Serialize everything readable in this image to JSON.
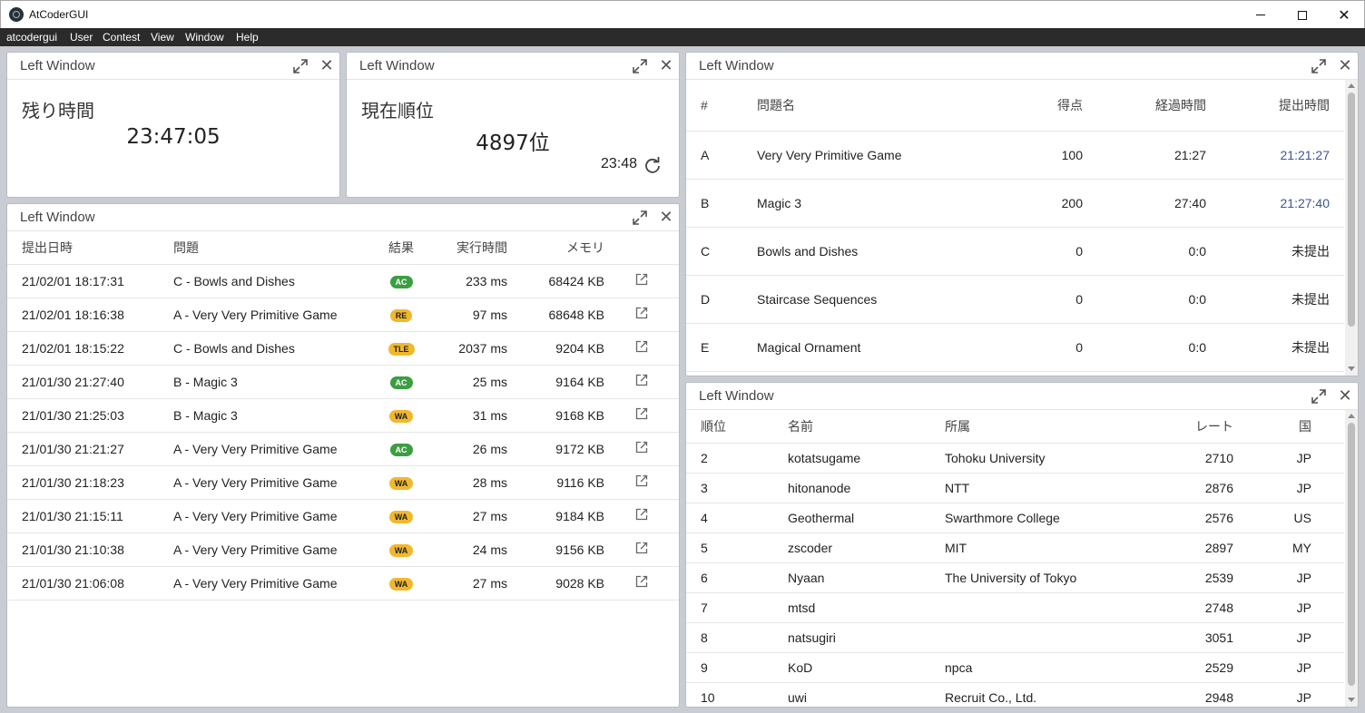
{
  "app": {
    "title": "AtCoderGUI"
  },
  "menu": [
    "atcodergui",
    "User",
    "Contest",
    "View",
    "Window",
    "Help"
  ],
  "panels": {
    "remaining": {
      "title": "Left Window",
      "label": "残り時間",
      "value": "23:47:05"
    },
    "rank": {
      "title": "Left Window",
      "label": "現在順位",
      "value": "4897位",
      "updated": "23:48"
    },
    "submissions": {
      "title": "Left Window",
      "headers": [
        "提出日時",
        "問題",
        "結果",
        "実行時間",
        "メモリ"
      ],
      "rows": [
        {
          "date": "21/02/01 18:17:31",
          "problem": "C - Bowls and Dishes",
          "result": "AC",
          "time": "233 ms",
          "memory": "68424 KB"
        },
        {
          "date": "21/02/01 18:16:38",
          "problem": "A - Very Very Primitive Game",
          "result": "RE",
          "time": "97 ms",
          "memory": "68648 KB"
        },
        {
          "date": "21/02/01 18:15:22",
          "problem": "C - Bowls and Dishes",
          "result": "TLE",
          "time": "2037 ms",
          "memory": "9204 KB"
        },
        {
          "date": "21/01/30 21:27:40",
          "problem": "B - Magic 3",
          "result": "AC",
          "time": "25 ms",
          "memory": "9164 KB"
        },
        {
          "date": "21/01/30 21:25:03",
          "problem": "B - Magic 3",
          "result": "WA",
          "time": "31 ms",
          "memory": "9168 KB"
        },
        {
          "date": "21/01/30 21:21:27",
          "problem": "A - Very Very Primitive Game",
          "result": "AC",
          "time": "26 ms",
          "memory": "9172 KB"
        },
        {
          "date": "21/01/30 21:18:23",
          "problem": "A - Very Very Primitive Game",
          "result": "WA",
          "time": "28 ms",
          "memory": "9116 KB"
        },
        {
          "date": "21/01/30 21:15:11",
          "problem": "A - Very Very Primitive Game",
          "result": "WA",
          "time": "27 ms",
          "memory": "9184 KB"
        },
        {
          "date": "21/01/30 21:10:38",
          "problem": "A - Very Very Primitive Game",
          "result": "WA",
          "time": "24 ms",
          "memory": "9156 KB"
        },
        {
          "date": "21/01/30 21:06:08",
          "problem": "A - Very Very Primitive Game",
          "result": "WA",
          "time": "27 ms",
          "memory": "9028 KB"
        }
      ]
    },
    "problems": {
      "title": "Left Window",
      "headers": [
        "#",
        "問題名",
        "得点",
        "経過時間",
        "提出時間"
      ],
      "rows": [
        {
          "id": "A",
          "name": "Very Very Primitive Game",
          "score": "100",
          "elapsed": "21:27",
          "submitted": "21:21:27",
          "linked": true
        },
        {
          "id": "B",
          "name": "Magic 3",
          "score": "200",
          "elapsed": "27:40",
          "submitted": "21:27:40",
          "linked": true
        },
        {
          "id": "C",
          "name": "Bowls and Dishes",
          "score": "0",
          "elapsed": "0:0",
          "submitted": "未提出",
          "linked": false
        },
        {
          "id": "D",
          "name": "Staircase Sequences",
          "score": "0",
          "elapsed": "0:0",
          "submitted": "未提出",
          "linked": false
        },
        {
          "id": "E",
          "name": "Magical Ornament",
          "score": "0",
          "elapsed": "0:0",
          "submitted": "未提出",
          "linked": false
        }
      ]
    },
    "standings": {
      "title": "Left Window",
      "headers": [
        "順位",
        "名前",
        "所属",
        "レート",
        "国"
      ],
      "rows": [
        {
          "rank": "2",
          "name": "kotatsugame",
          "affiliation": "Tohoku University",
          "rating": "2710",
          "country": "JP"
        },
        {
          "rank": "3",
          "name": "hitonanode",
          "affiliation": "NTT",
          "rating": "2876",
          "country": "JP"
        },
        {
          "rank": "4",
          "name": "Geothermal",
          "affiliation": "Swarthmore College",
          "rating": "2576",
          "country": "US"
        },
        {
          "rank": "5",
          "name": "zscoder",
          "affiliation": "MIT",
          "rating": "2897",
          "country": "MY"
        },
        {
          "rank": "6",
          "name": "Nyaan",
          "affiliation": "The University of Tokyo",
          "rating": "2539",
          "country": "JP"
        },
        {
          "rank": "7",
          "name": "mtsd",
          "affiliation": "",
          "rating": "2748",
          "country": "JP"
        },
        {
          "rank": "8",
          "name": "natsugiri",
          "affiliation": "",
          "rating": "3051",
          "country": "JP"
        },
        {
          "rank": "9",
          "name": "KoD",
          "affiliation": "npca",
          "rating": "2529",
          "country": "JP"
        },
        {
          "rank": "10",
          "name": "uwi",
          "affiliation": "Recruit Co., Ltd.",
          "rating": "2948",
          "country": "JP"
        }
      ]
    }
  },
  "colors": {
    "ac": "#3b9e43",
    "warn": "#f1b82e",
    "link": "#3e5596",
    "menubar": "#2b2b2b"
  }
}
